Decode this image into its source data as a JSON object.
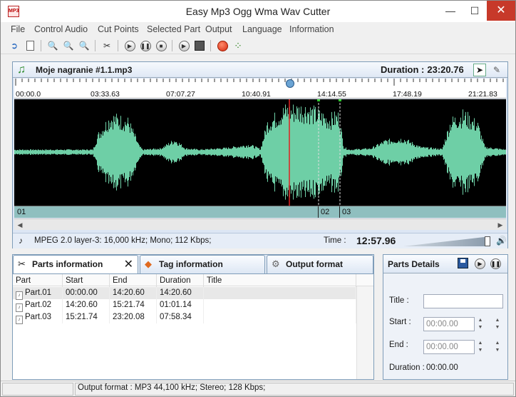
{
  "window": {
    "title": "Easy Mp3 Ogg Wma Wav Cutter",
    "min_glyph": "—",
    "max_glyph": "☐",
    "close_glyph": "✕"
  },
  "menu": [
    "File",
    "Control Audio",
    "Cut Points",
    "Selected Part",
    "Output",
    "Language",
    "Information"
  ],
  "toolbar": {
    "buttons": [
      "open-icon",
      "new-icon",
      "zoom-in-icon",
      "zoom-out-icon",
      "zoom-fit-icon",
      "cut-icon",
      "play-icon",
      "pause-icon",
      "stop-icon",
      "play-part-icon",
      "save-icon",
      "record-icon",
      "split-icon"
    ]
  },
  "audio": {
    "file_name": "Moje nagranie #1.1.mp3",
    "duration_label": "Duration :",
    "duration_value": "23:20.76",
    "ruler_labels": [
      "00:00.0",
      "03:33.63",
      "07:07.27",
      "10:40.91",
      "14:14.55",
      "17:48.19",
      "21:21.83"
    ],
    "parts_labels": [
      "01",
      "02",
      "03"
    ],
    "info": "MPEG 2.0 layer-3: 16,000 kHz; Mono; 112 Kbps;",
    "time_label": "Time :",
    "time_value": "12:57.96",
    "volume": 0.95,
    "wave_color": "#6ecfa6",
    "playhead_color": "#e02020"
  },
  "parts_panel": {
    "tabs": [
      {
        "label": "Parts information",
        "icon": "scissors-icon"
      },
      {
        "label": "Tag information",
        "icon": "tag-icon"
      },
      {
        "label": "Output format",
        "icon": "output-icon"
      }
    ],
    "columns": [
      "Part",
      "Start",
      "End",
      "Duration",
      "Title"
    ],
    "rows": [
      {
        "part": "Part.01",
        "start": "00:00.00",
        "end": "14:20.60",
        "duration": "14:20.60",
        "title": ""
      },
      {
        "part": "Part.02",
        "start": "14:20.60",
        "end": "15:21.74",
        "duration": "01:01.14",
        "title": ""
      },
      {
        "part": "Part.03",
        "start": "15:21.74",
        "end": "23:20.08",
        "duration": "07:58.34",
        "title": ""
      }
    ]
  },
  "details": {
    "title": "Parts Details",
    "title_label": "Title :",
    "title_value": "",
    "start_label": "Start :",
    "start_value": "00:00.00",
    "end_label": "End :",
    "end_value": "00:00.00",
    "duration_label": "Duration :",
    "duration_value": "00:00.00"
  },
  "status": {
    "text": "Output format : MP3 44,100 kHz; Stereo;  128 Kbps;"
  }
}
